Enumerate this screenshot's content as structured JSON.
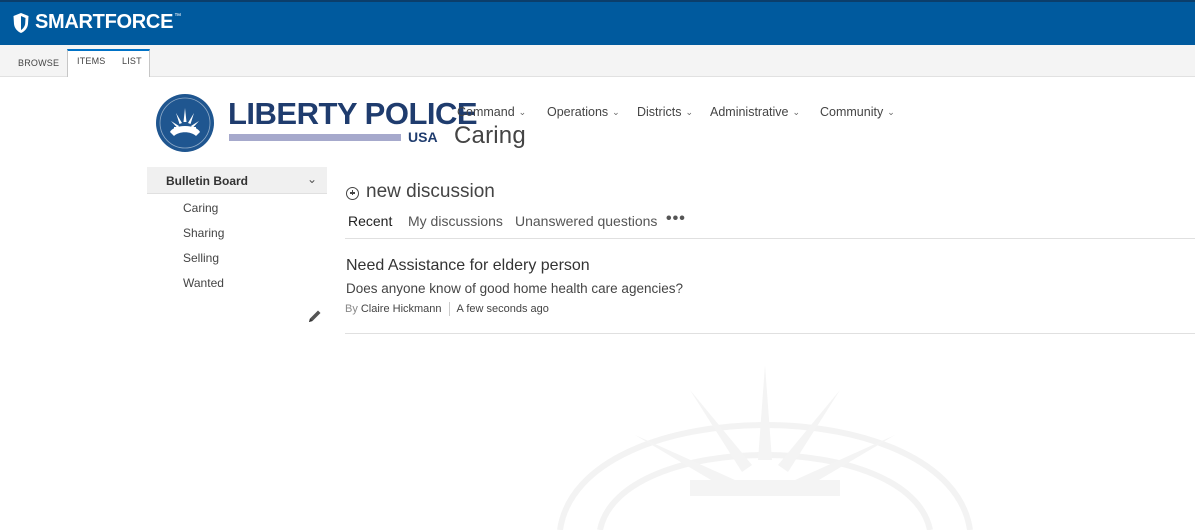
{
  "suite": {
    "brand": "SMARTFORCE",
    "trademark": "™",
    "brand_color": "#005a9e"
  },
  "ribbon": {
    "tabs": [
      "BROWSE",
      "ITEMS",
      "LIST"
    ],
    "accent": "#0072c6"
  },
  "logo": {
    "name": "LIBERTY POLICE",
    "country": "USA",
    "name_color": "#1f3c6e",
    "bar_color": "#a6a9cc"
  },
  "topnav": [
    {
      "label": "Command"
    },
    {
      "label": "Operations"
    },
    {
      "label": "Districts"
    },
    {
      "label": "Administrative"
    },
    {
      "label": "Community"
    }
  ],
  "site": {
    "title": "Caring"
  },
  "leftnav": {
    "heading": "Bulletin Board",
    "items": [
      "Caring",
      "Sharing",
      "Selling",
      "Wanted"
    ]
  },
  "main": {
    "new_discussion": "new discussion",
    "filters": [
      "Recent",
      "My discussions",
      "Unanswered questions"
    ],
    "more": "•••",
    "discussion": {
      "title": "Need Assistance for eldery person",
      "body": "Does anyone know of good home health care agencies?",
      "by": "By",
      "author": "Claire Hickmann",
      "time": "A few seconds ago"
    }
  }
}
